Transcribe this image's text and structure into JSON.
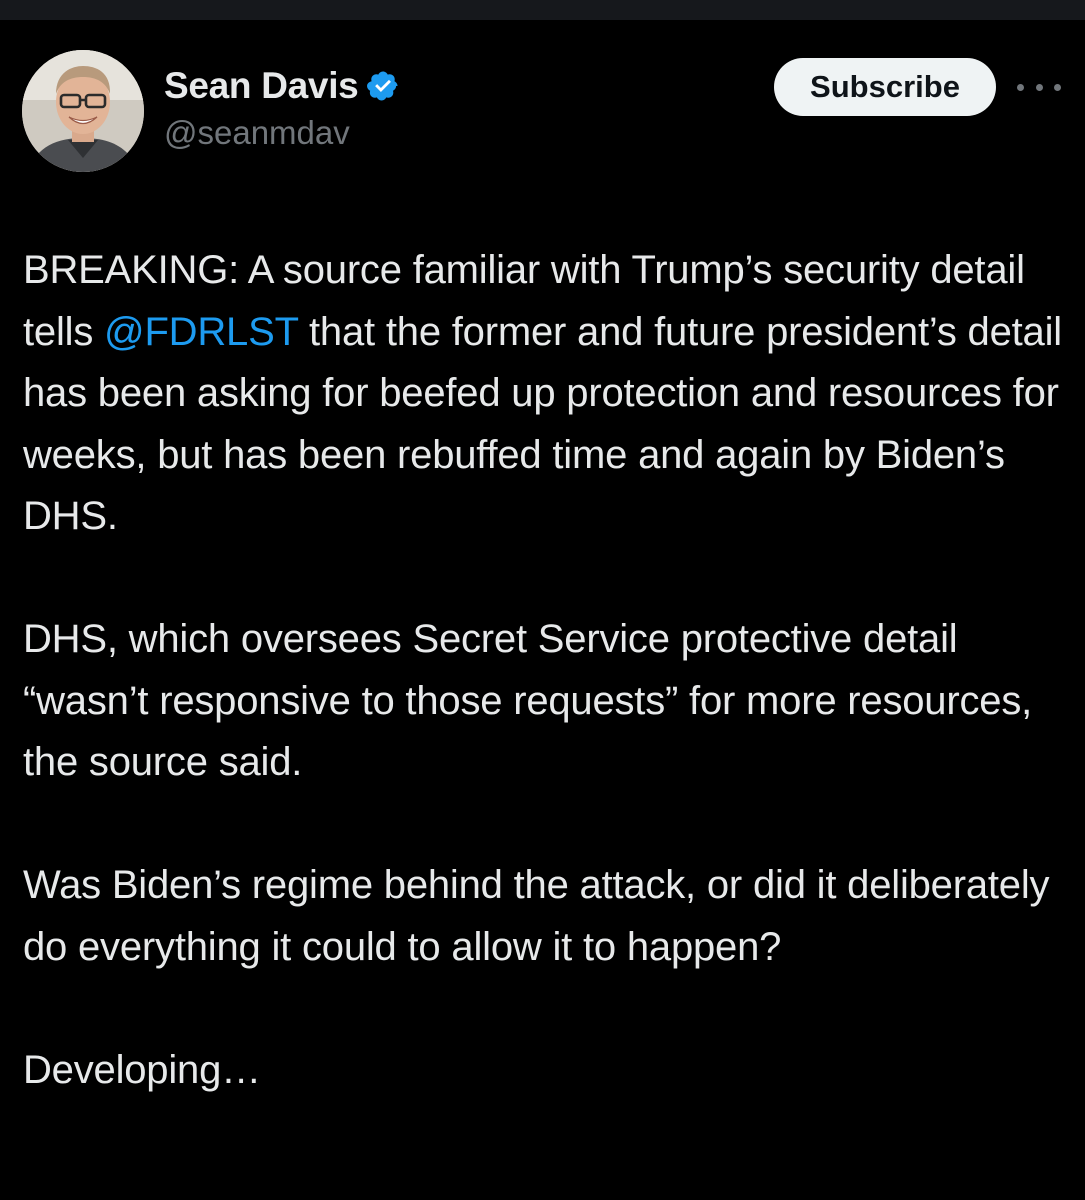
{
  "author": {
    "display_name": "Sean Davis",
    "handle": "@seanmdav",
    "verified": true,
    "verified_color": "#1d9bf0"
  },
  "actions": {
    "subscribe_label": "Subscribe",
    "more_icon": "more-horizontal-icon"
  },
  "tweet": {
    "p1_a": "BREAKING: A source familiar with Trump’s security detail tells ",
    "p1_mention": "@FDRLST",
    "p1_b": " that the former and future president’s detail has been asking for beefed up protection and resources for weeks, but has been rebuffed time and again by Biden’s DHS.",
    "p2": "DHS, which oversees Secret Service protective detail “wasn’t responsive to those requests” for more resources, the source said.",
    "p3": "Was Biden’s regime behind the attack, or did it deliberately do everything it could to allow it to happen?",
    "p4": "Developing…"
  },
  "colors": {
    "background": "#000000",
    "text": "#e7e9ea",
    "secondary": "#71767b",
    "link": "#1d9bf0",
    "button_bg": "#eff3f4"
  }
}
